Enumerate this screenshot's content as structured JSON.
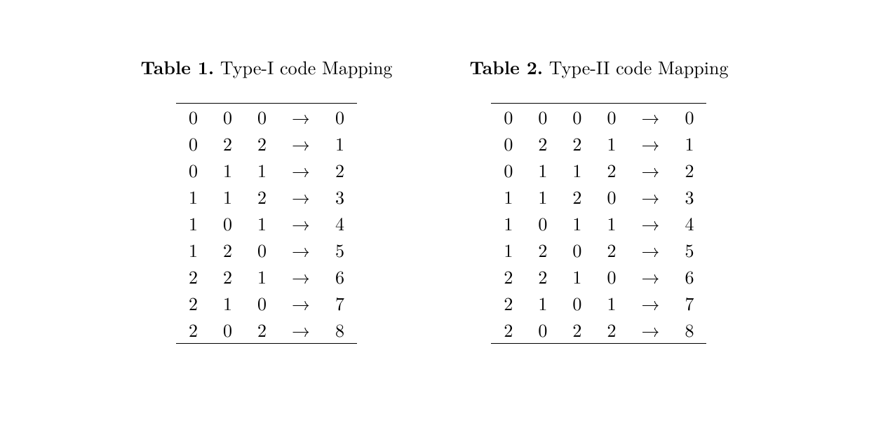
{
  "tables": [
    {
      "label": "Table 1.",
      "title": " Type-I code Mapping",
      "arrow": "→",
      "columns": 3,
      "rows": [
        {
          "in": [
            "0",
            "0",
            "0"
          ],
          "arrow": "→",
          "out": "0"
        },
        {
          "in": [
            "0",
            "2",
            "2"
          ],
          "arrow": "→",
          "out": "1"
        },
        {
          "in": [
            "0",
            "1",
            "1"
          ],
          "arrow": "→",
          "out": "2"
        },
        {
          "in": [
            "1",
            "1",
            "2"
          ],
          "arrow": "→",
          "out": "3"
        },
        {
          "in": [
            "1",
            "0",
            "1"
          ],
          "arrow": "→",
          "out": "4"
        },
        {
          "in": [
            "1",
            "2",
            "0"
          ],
          "arrow": "→",
          "out": "5"
        },
        {
          "in": [
            "2",
            "2",
            "1"
          ],
          "arrow": "→",
          "out": "6"
        },
        {
          "in": [
            "2",
            "1",
            "0"
          ],
          "arrow": "→",
          "out": "7"
        },
        {
          "in": [
            "2",
            "0",
            "2"
          ],
          "arrow": "→",
          "out": "8"
        }
      ]
    },
    {
      "label": "Table 2.",
      "title": " Type-II code Mapping",
      "arrow": "→",
      "columns": 4,
      "rows": [
        {
          "in": [
            "0",
            "0",
            "0",
            "0"
          ],
          "arrow": "→",
          "out": "0"
        },
        {
          "in": [
            "0",
            "2",
            "2",
            "1"
          ],
          "arrow": "→",
          "out": "1"
        },
        {
          "in": [
            "0",
            "1",
            "1",
            "2"
          ],
          "arrow": "→",
          "out": "2"
        },
        {
          "in": [
            "1",
            "1",
            "2",
            "0"
          ],
          "arrow": "→",
          "out": "3"
        },
        {
          "in": [
            "1",
            "0",
            "1",
            "1"
          ],
          "arrow": "→",
          "out": "4"
        },
        {
          "in": [
            "1",
            "2",
            "0",
            "2"
          ],
          "arrow": "→",
          "out": "5"
        },
        {
          "in": [
            "2",
            "2",
            "1",
            "0"
          ],
          "arrow": "→",
          "out": "6"
        },
        {
          "in": [
            "2",
            "1",
            "0",
            "1"
          ],
          "arrow": "→",
          "out": "7"
        },
        {
          "in": [
            "2",
            "0",
            "2",
            "2"
          ],
          "arrow": "→",
          "out": "8"
        }
      ]
    }
  ]
}
